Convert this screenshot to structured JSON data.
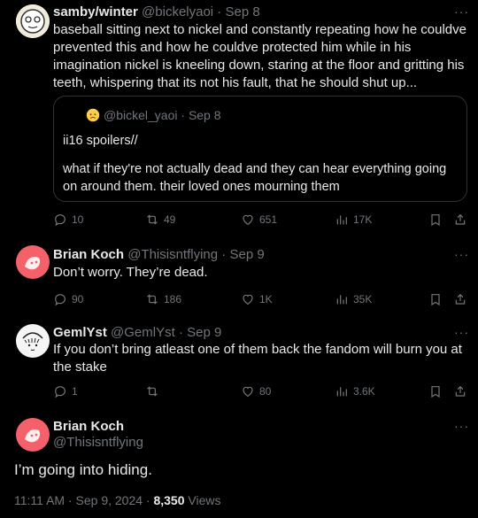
{
  "tweets": [
    {
      "name": "samby/winter",
      "handle": "@bickelyaoi",
      "date": "Sep 8",
      "text": "baseball sitting next to nickel and constantly repeating how he couldve prevented this and how he couldve protected him while in his imagination nickel is kneeling down, staring at the floor and gritting his teeth, whispering that its not his fault, that he should shut up...",
      "quote": {
        "handle": "@bickel_yaoi",
        "date": "Sep 8",
        "line1": "ii16 spoilers//",
        "line2": "what if they're not actually dead and they can hear everything going on around them. their loved ones mourning them"
      },
      "replies": "10",
      "retweets": "49",
      "likes": "651",
      "views": "17K"
    },
    {
      "name": "Brian Koch",
      "handle": "@Thisisntflying",
      "date": "Sep 9",
      "text": "Don’t worry. They’re dead.",
      "replies": "90",
      "retweets": "186",
      "likes": "1K",
      "views": "35K"
    },
    {
      "name": "GemlYst",
      "handle": "@GemlYst",
      "date": "Sep 9",
      "text": "If you don’t bring atleast one of them back the fandom will burn you at the stake",
      "replies": "1",
      "retweets": "",
      "likes": "80",
      "views": "3.6K"
    }
  ],
  "main": {
    "name": "Brian Koch",
    "handle": "@Thisisntflying",
    "text": "I’m going into hiding.",
    "time": "11:11 AM · Sep 9, 2024 · ",
    "views_count": "8,350",
    "views_label": " Views"
  },
  "sep": " · ",
  "more": "···",
  "colors": {
    "bg": "#000000",
    "text": "#e7e9ea",
    "muted": "#71767b",
    "border": "#2f3336",
    "avatar_red": "#f4616b"
  },
  "icons": [
    "reply-icon",
    "retweet-icon",
    "like-icon",
    "views-icon",
    "bookmark-icon",
    "share-icon",
    "more-icon",
    "worried-emoji-icon"
  ]
}
